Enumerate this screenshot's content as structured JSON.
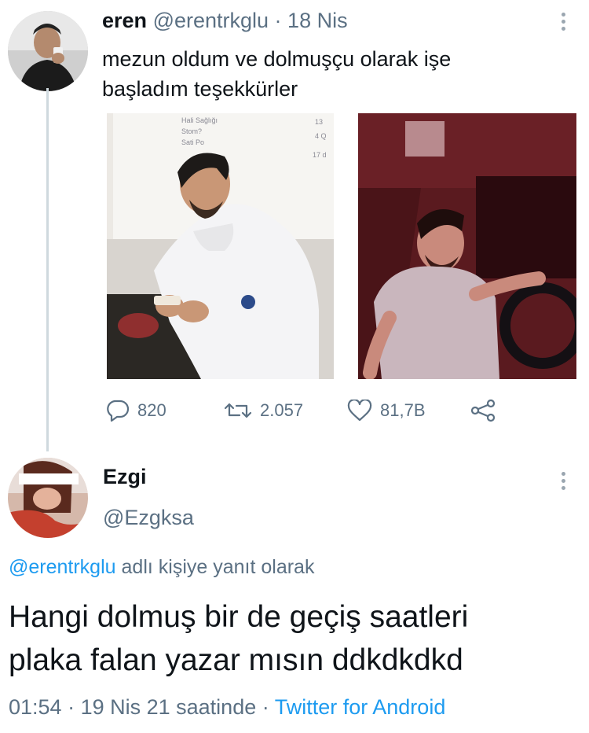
{
  "tweet": {
    "author_name": "eren",
    "author_handle": "@erentrkglu",
    "separator": " · ",
    "date": "18 Nis",
    "text_line1": "mezun oldum ve dolmuşçu olarak işe",
    "text_line2": "başladım teşekkürler",
    "board_text": [
      "Hali Sağlığı",
      "Stom?",
      "Sati Po",
      "13",
      "4 Q",
      "17 d"
    ],
    "stats": {
      "replies": "820",
      "retweets": "2.057",
      "likes": "81,7B"
    }
  },
  "reply": {
    "author_name": "Ezgi",
    "author_handle": "@Ezgksa",
    "reply_to_handle": "@erentrkglu",
    "reply_to_suffix": " adlı kişiye yanıt olarak",
    "text_line1": "Hangi dolmuş bir de geçiş saatleri",
    "text_line2": "plaka falan yazar mısın ddkdkdkd",
    "time": "01:54",
    "separator": " · ",
    "date_suffix": "19 Nis 21 saatinde · ",
    "source": "Twitter for Android"
  },
  "colors": {
    "link": "#1d9bf0",
    "muted": "#5b7083",
    "text": "#0f1419",
    "thread_line": "#cfd9de"
  }
}
